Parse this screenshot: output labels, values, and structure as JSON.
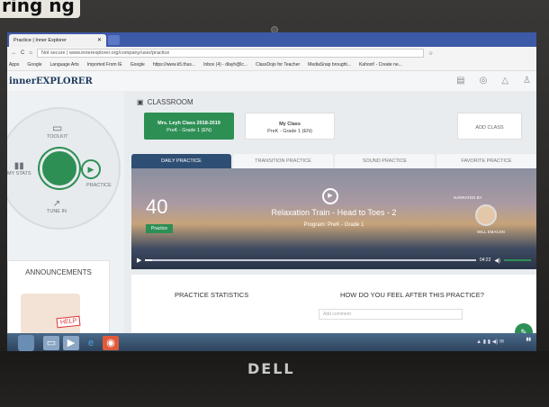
{
  "browser": {
    "tab_title": "Practice | Inner Explorer",
    "url": "Not secure | www.innerexplorer.org/company/user/practice",
    "bookmarks": [
      "Apps",
      "Google",
      "Language Arts",
      "Imported From IE",
      "Google",
      "https://www.k5.thus...",
      "Inbox (4) - dlayh@lc...",
      "ClassDojo for Teacher",
      "MediaSnap brought...",
      "Kahoot! - Create ne..."
    ]
  },
  "app": {
    "logo": "innerEXPLORER",
    "classroom_title": "CLASSROOM",
    "cards": [
      {
        "name": "Mrs. Leyh Class 2018-2019",
        "grade": "PreK - Grade 1 (EN)"
      },
      {
        "name": "My Class",
        "grade": "PreK - Grade 1 (EN)"
      }
    ],
    "add_class": "ADD CLASS",
    "wheel": {
      "toolkit": "TOOLKIT",
      "my_stats": "MY STATS",
      "practice": "PRACTICE",
      "tune_in": "TUNE IN"
    },
    "tabs": [
      "DAILY PRACTICE",
      "TRANSITION PRACTICE",
      "SOUND PRACTICE",
      "FAVORITE PRACTICE"
    ],
    "video": {
      "count": "40",
      "badge": "Practice",
      "title": "Relaxation Train - Head to Toes - 2",
      "program": "Program: PreK - Grade 1",
      "narrated": "NARRATED BY",
      "narrator": "WILL EMACSN",
      "time": "04:22"
    },
    "announcements": "ANNOUNCEMENTS",
    "help": "HELP",
    "stats_label": "PRACTICE STATISTICS",
    "feel_label": "HOW DO YOU FEEL AFTER THIS PRACTICE?",
    "comment_placeholder": "Add comment"
  },
  "laptop": {
    "brand": "DELL"
  },
  "caption": "ring ng"
}
